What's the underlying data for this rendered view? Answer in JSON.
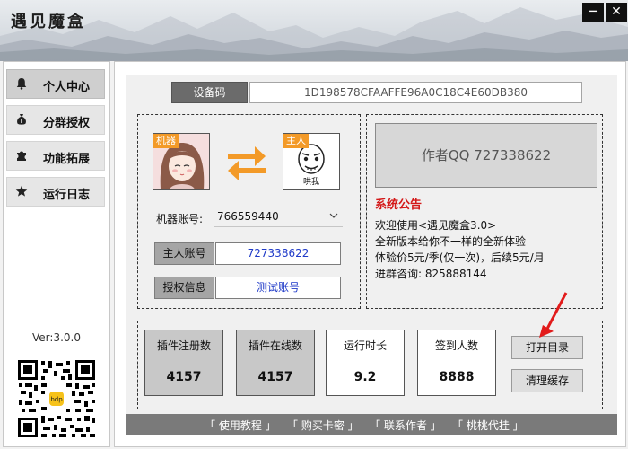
{
  "window": {
    "title": "遇见魔盒",
    "minimize_glyph": "─",
    "close_glyph": "✕"
  },
  "sidebar": {
    "items": [
      {
        "label": "个人中心",
        "icon": "bell-icon",
        "active": true
      },
      {
        "label": "分群授权",
        "icon": "money-bag-icon",
        "active": false
      },
      {
        "label": "功能拓展",
        "icon": "puzzle-icon",
        "active": false
      },
      {
        "label": "运行日志",
        "icon": "star-icon",
        "active": false
      }
    ],
    "version": "Ver:3.0.0",
    "qr_badge": "bdp"
  },
  "device": {
    "label": "设备码",
    "value": "1D198578CFAAFFE96A0C18C4E60DB380"
  },
  "accounts": {
    "robot_avatar_tag": "机器",
    "owner_avatar_tag": "主人",
    "owner_avatar_caption": "哄我",
    "robot_label": "机器账号:",
    "robot_value": "766559440",
    "owner_label": "主人账号",
    "owner_value": "727338622",
    "auth_label": "授权信息",
    "auth_value": "测试账号"
  },
  "notice": {
    "author_qq": "作者QQ  727338622",
    "title": "系统公告",
    "lines": [
      "欢迎使用<遇见魔盒3.0>",
      "全新版本给你不一样的全新体验",
      "体验价5元/季(仅一次)，后续5元/月",
      "进群咨询: 825888144"
    ]
  },
  "stats": [
    {
      "label": "插件注册数",
      "value": "4157"
    },
    {
      "label": "插件在线数",
      "value": "4157"
    },
    {
      "label": "运行时长",
      "value": "9.2"
    },
    {
      "label": "签到人数",
      "value": "8888"
    }
  ],
  "actions": {
    "open_dir": "打开目录",
    "clear_cache": "清理缓存"
  },
  "footer": {
    "links": [
      "「 使用教程 」",
      "「 购买卡密 」",
      "「 联系作者 」",
      "「 桃桃代挂 」"
    ]
  },
  "colors": {
    "accent_orange": "#f39a28",
    "notice_red": "#d41919",
    "link_blue": "#1f3ac8",
    "footer_gray": "#7a7a7a"
  }
}
